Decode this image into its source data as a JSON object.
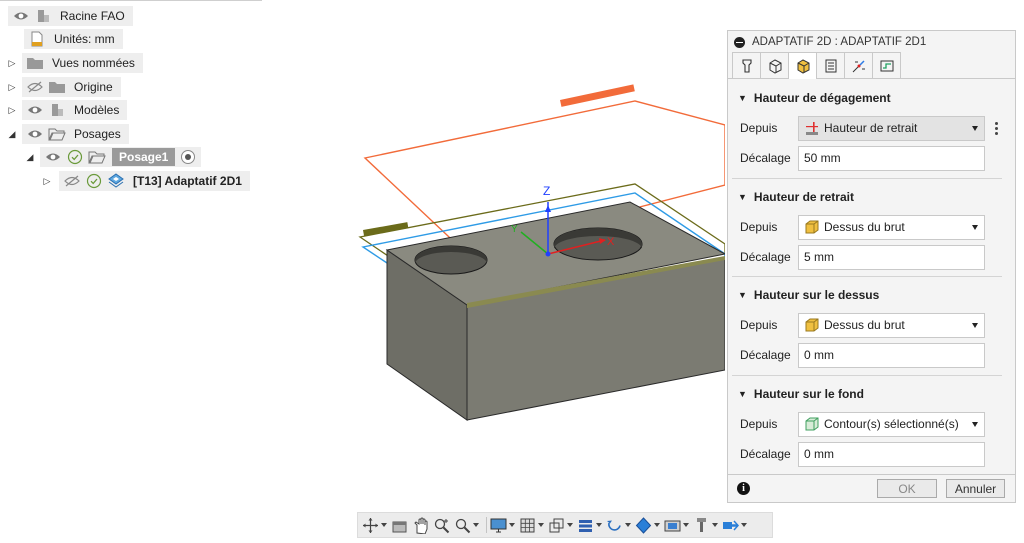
{
  "browser": {
    "root_label": "Racine FAO",
    "units_label": "Unités: mm",
    "named_views_label": "Vues nommées",
    "origin_label": "Origine",
    "models_label": "Modèles",
    "setups_label": "Posages",
    "setup1_label": "Posage1",
    "operation_label": "[T13] Adaptatif 2D1"
  },
  "viewport": {
    "axis_z": "Z",
    "axis_x": "X",
    "axis_y": "Y"
  },
  "panel": {
    "title": "ADAPTATIF 2D : ADAPTATIF 2D1",
    "tabs": [
      "tool-icon",
      "geometry-icon",
      "heights-icon",
      "passes-icon",
      "linking-icon",
      "simulation-icon"
    ],
    "active_tab_index": 2,
    "sections": {
      "clearance": {
        "title": "Hauteur de dégagement",
        "from_label": "Depuis",
        "from_value": "Hauteur de retrait",
        "offset_label": "Décalage",
        "offset_value": "50 mm"
      },
      "retract": {
        "title": "Hauteur de retrait",
        "from_label": "Depuis",
        "from_value": "Dessus du brut",
        "offset_label": "Décalage",
        "offset_value": "5 mm"
      },
      "top": {
        "title": "Hauteur sur le dessus",
        "from_label": "Depuis",
        "from_value": "Dessus du brut",
        "offset_label": "Décalage",
        "offset_value": "0 mm"
      },
      "bottom": {
        "title": "Hauteur sur le fond",
        "from_label": "Depuis",
        "from_value": "Contour(s) sélectionné(s)",
        "offset_label": "Décalage",
        "offset_value": "0 mm"
      }
    },
    "ok_label": "OK",
    "cancel_label": "Annuler",
    "colors": {
      "clearance_plane": "#f26b3a",
      "retract_plane": "#6b6b1a",
      "top_plane": "#2e9be6",
      "stock": "#7a7a70"
    }
  },
  "toolbar": {
    "items": [
      "orbit-icon",
      "look-at-icon",
      "pan-icon",
      "zoom-icon",
      "fit-icon",
      "display-icon",
      "grid-icon",
      "view-cube-icon",
      "section-icon",
      "refresh-icon",
      "appearance-icon",
      "camera-icon",
      "tool-display-icon",
      "machine-icon"
    ]
  }
}
